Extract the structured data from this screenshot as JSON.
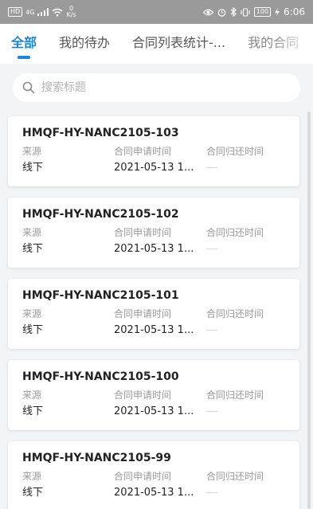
{
  "statusbar": {
    "network": "HD",
    "signal": "4G",
    "speed_value": "0",
    "speed_unit": "K/s",
    "battery": "100",
    "time": "6:06"
  },
  "tabs": [
    {
      "label": "全部",
      "active": true
    },
    {
      "label": "我的待办",
      "active": false
    },
    {
      "label": "合同列表统计-...",
      "active": false
    },
    {
      "label": "我的合同",
      "active": false
    }
  ],
  "search": {
    "placeholder": "搜索标题",
    "value": ""
  },
  "columns": {
    "source": "来源",
    "apply_time": "合同申请时间",
    "return_time": "合同归还时间"
  },
  "contracts": [
    {
      "title": "HMQF-HY-NANC2105-103",
      "source": "线下",
      "apply_time": "2021-05-13 1...",
      "return_time": ""
    },
    {
      "title": "HMQF-HY-NANC2105-102",
      "source": "线下",
      "apply_time": "2021-05-13 1...",
      "return_time": ""
    },
    {
      "title": "HMQF-HY-NANC2105-101",
      "source": "线下",
      "apply_time": "2021-05-13 1...",
      "return_time": ""
    },
    {
      "title": "HMQF-HY-NANC2105-100",
      "source": "线下",
      "apply_time": "2021-05-13 1...",
      "return_time": ""
    },
    {
      "title": "HMQF-HY-NANC2105-99",
      "source": "线下",
      "apply_time": "2021-05-13 1...",
      "return_time": ""
    }
  ],
  "colors": {
    "accent": "#1f84d6",
    "statusbar": "#9a9a9a",
    "background": "#f3f4f6"
  }
}
